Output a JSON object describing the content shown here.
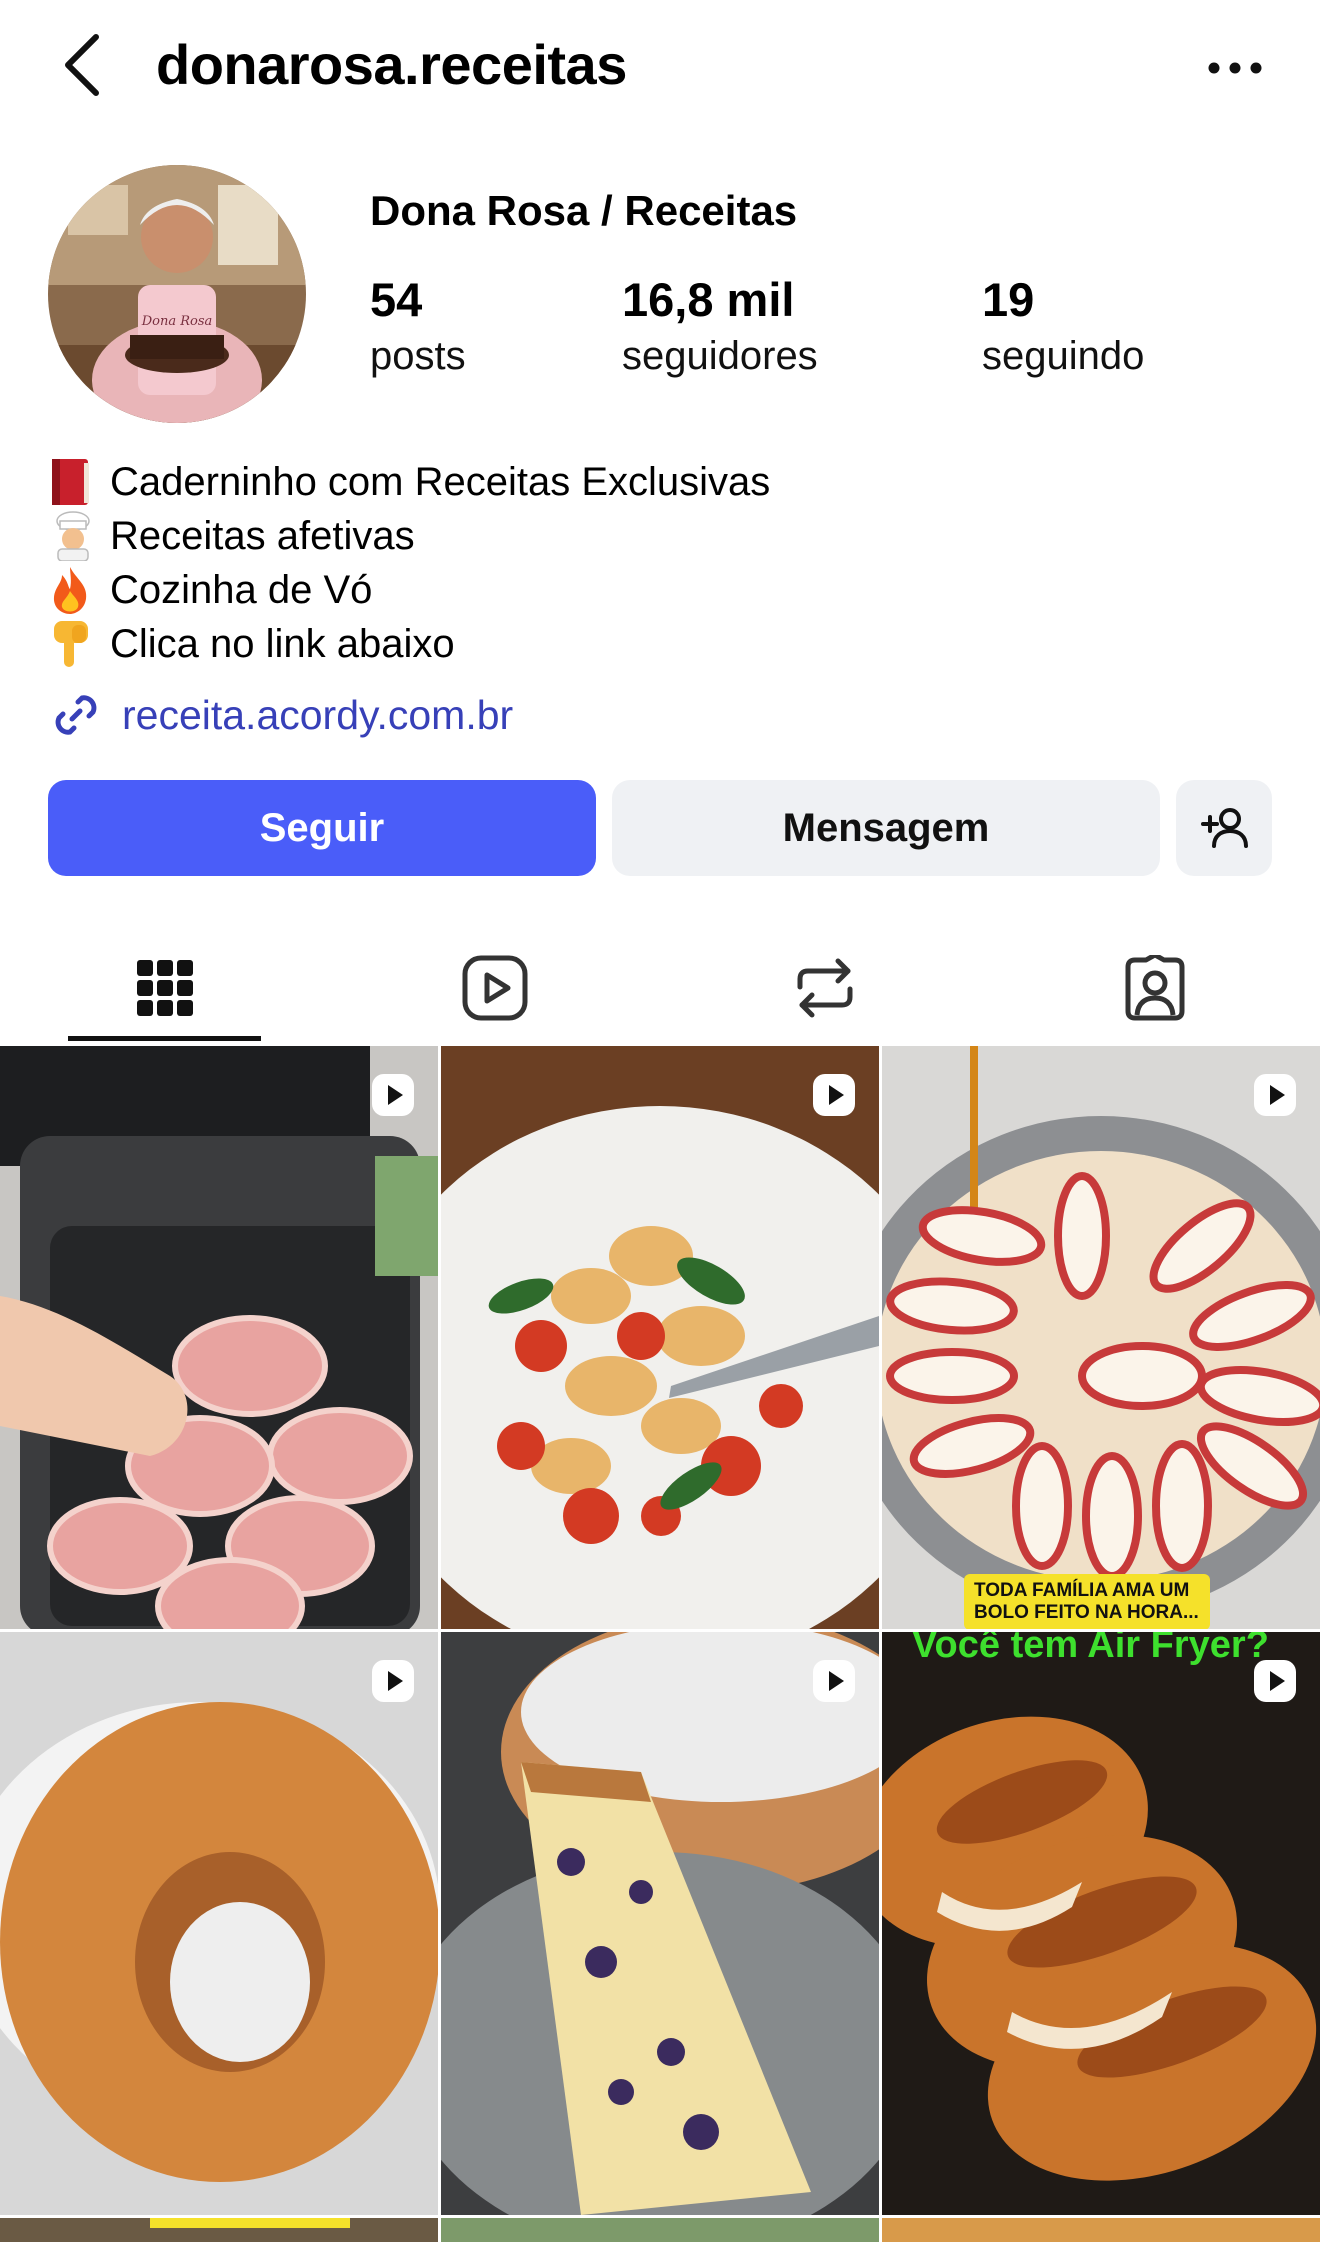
{
  "header": {
    "username": "donarosa.receitas",
    "back_icon": "chevron-left-icon",
    "more_icon": "more-horizontal-icon"
  },
  "profile": {
    "display_name": "Dona Rosa / Receitas",
    "avatar_text": "Dona Rosa",
    "stats": {
      "posts": {
        "value": "54",
        "label": "posts"
      },
      "followers": {
        "value": "16,8 mil",
        "label": "seguidores"
      },
      "following": {
        "value": "19",
        "label": "seguindo"
      }
    }
  },
  "bio": {
    "lines": [
      {
        "emoji": "closed-book-icon",
        "text": "Caderninho com Receitas Exclusivas"
      },
      {
        "emoji": "cook-icon",
        "text": "Receitas afetivas"
      },
      {
        "emoji": "fire-icon",
        "text": "Cozinha de Vó"
      },
      {
        "emoji": "pointing-down-icon",
        "text": "Clica no link abaixo"
      }
    ],
    "link": "receita.acordy.com.br"
  },
  "actions": {
    "follow_label": "Seguir",
    "message_label": "Mensagem",
    "suggest_icon": "add-person-icon"
  },
  "tabs": [
    {
      "name": "grid",
      "icon": "grid-icon",
      "active": true
    },
    {
      "name": "reels",
      "icon": "reels-icon",
      "active": false
    },
    {
      "name": "reposts",
      "icon": "repost-icon",
      "active": false
    },
    {
      "name": "tagged",
      "icon": "tagged-icon",
      "active": false
    }
  ],
  "posts": [
    {
      "subject": "bacon-wrapped rolls in air fryer",
      "type": "reel"
    },
    {
      "subject": "pasta with cherry tomatoes",
      "type": "reel"
    },
    {
      "subject": "apple cake batter",
      "type": "reel",
      "caption": "TODA FAMÍLIA AMA UM BOLO FEITO NA HORA..."
    },
    {
      "subject": "bundt cake",
      "type": "reel"
    },
    {
      "subject": "blueberry cake slice",
      "type": "reel"
    },
    {
      "subject": "glazed chicken",
      "type": "reel",
      "caption": "Você tem Air Fryer?"
    }
  ],
  "colors": {
    "accent": "#4a5df9",
    "secondary_button": "#eff1f4",
    "link": "#3740b8",
    "caption_bg": "#f5e12a",
    "banner_text": "#3ee02e"
  }
}
